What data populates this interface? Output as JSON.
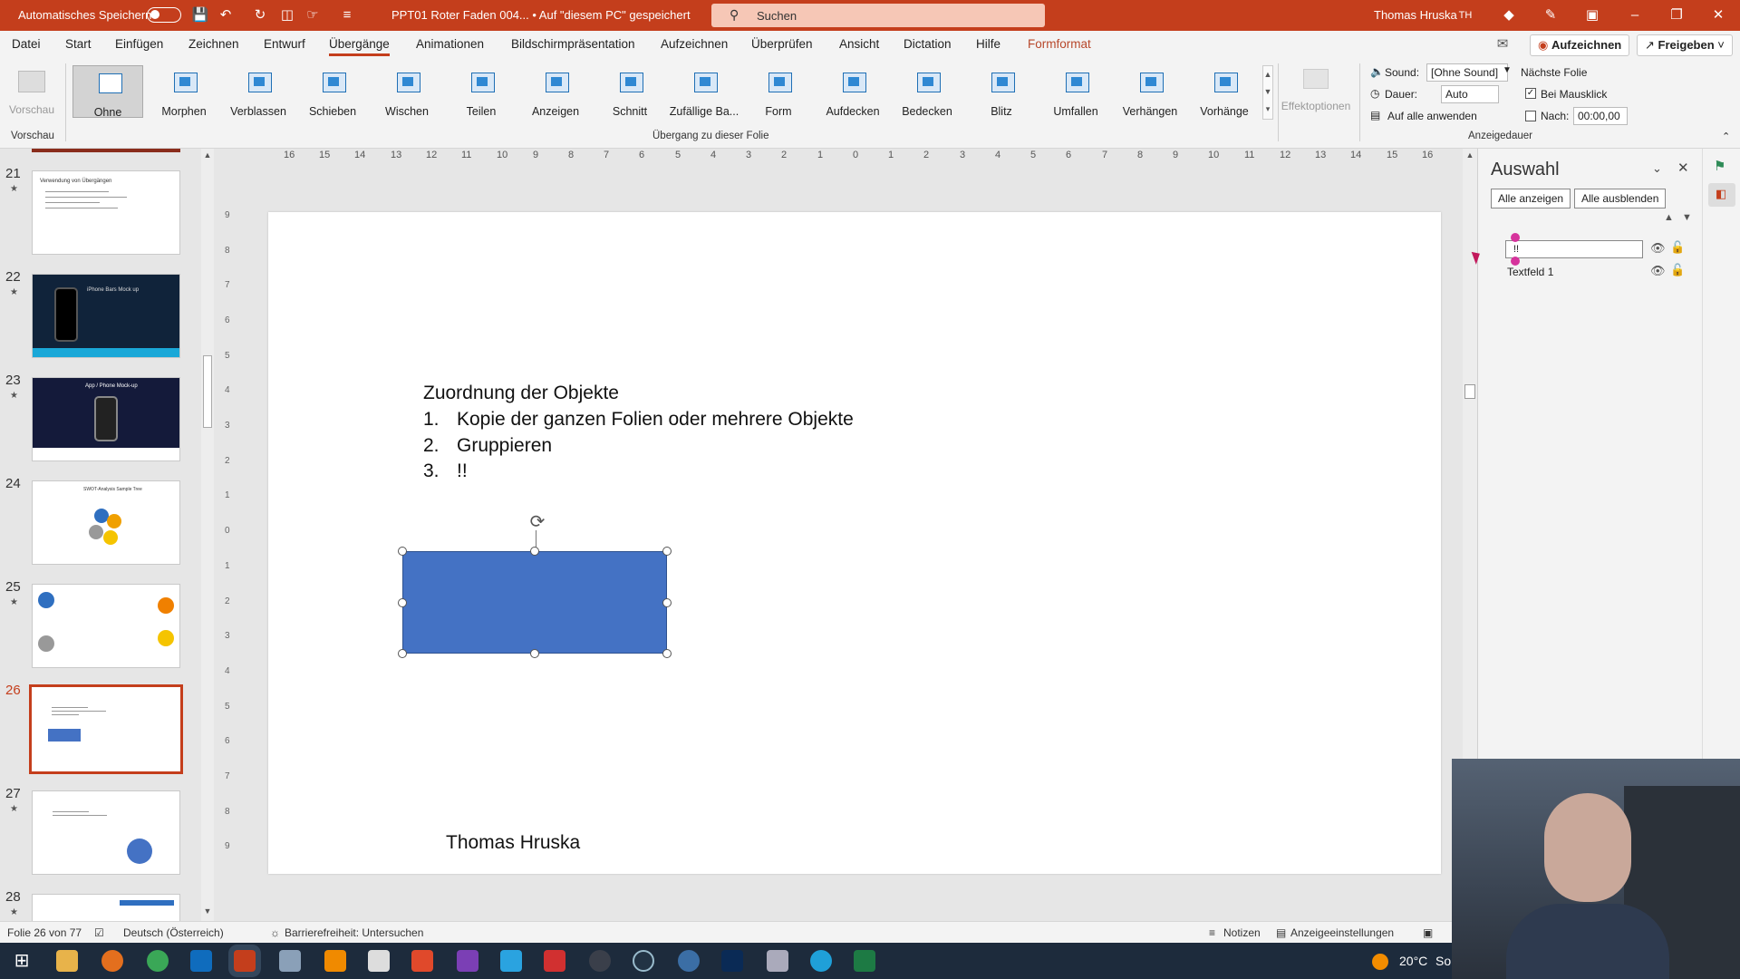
{
  "titlebar": {
    "autosave_label": "Automatisches Speichern",
    "doc_title": "PPT01 Roter Faden 004...  •  Auf \"diesem PC\" gespeichert",
    "search_placeholder": "Suchen",
    "user_name": "Thomas Hruska",
    "user_initials": "TH"
  },
  "menu": {
    "items": [
      "Datei",
      "Start",
      "Einfügen",
      "Zeichnen",
      "Entwurf",
      "Übergänge",
      "Animationen",
      "Bildschirmpräsentation",
      "Aufzeichnen",
      "Überprüfen",
      "Ansicht",
      "Dictation",
      "Hilfe",
      "Formformat"
    ],
    "active": "Übergänge",
    "record_button": "Aufzeichnen",
    "share_button": "Freigeben"
  },
  "ribbon": {
    "preview_label": "Vorschau",
    "preview_group": "Vorschau",
    "transitions": [
      "Ohne",
      "Morphen",
      "Verblassen",
      "Schieben",
      "Wischen",
      "Teilen",
      "Anzeigen",
      "Schnitt",
      "Zufällige Ba...",
      "Form",
      "Aufdecken",
      "Bedecken",
      "Blitz",
      "Umfallen",
      "Verhängen",
      "Vorhänge"
    ],
    "selected_transition": "Ohne",
    "transition_group": "Übergang zu dieser Folie",
    "effect_options": "Effektoptionen",
    "sound_label": "Sound:",
    "sound_value": "[Ohne Sound]",
    "duration_label": "Dauer:",
    "duration_value": "Auto",
    "apply_all": "Auf alle anwenden",
    "next_slide": "Nächste Folie",
    "on_click": "Bei Mausklick",
    "on_click_checked": true,
    "after_label": "Nach:",
    "after_value": "00:00,00",
    "after_checked": false,
    "timing_group": "Anzeigedauer"
  },
  "thumbnails": {
    "items": [
      {
        "num": "21",
        "star": "★"
      },
      {
        "num": "22",
        "star": "★"
      },
      {
        "num": "23",
        "star": "★"
      },
      {
        "num": "24",
        "star": ""
      },
      {
        "num": "25",
        "star": "★"
      },
      {
        "num": "26",
        "star": ""
      },
      {
        "num": "27",
        "star": "★"
      },
      {
        "num": "28",
        "star": "★"
      }
    ],
    "selected": "26",
    "thumb21_title": "Verwendung von Übergängen",
    "thumb22_title": "iPhone Bars Mock up",
    "thumb23_title": "App / Phone Mock-up",
    "thumb24_title": "SWOT-Analysis Sample Tree"
  },
  "ruler": {
    "labels": [
      "16",
      "15",
      "14",
      "13",
      "12",
      "11",
      "10",
      "9",
      "8",
      "7",
      "6",
      "5",
      "4",
      "3",
      "2",
      "1",
      "0",
      "1",
      "2",
      "3",
      "4",
      "5",
      "6",
      "7",
      "8",
      "9",
      "10",
      "11",
      "12",
      "13",
      "14",
      "15",
      "16"
    ],
    "vlabels": [
      "9",
      "8",
      "7",
      "6",
      "5",
      "4",
      "3",
      "2",
      "1",
      "0",
      "1",
      "2",
      "3",
      "4",
      "5",
      "6",
      "7",
      "8",
      "9"
    ]
  },
  "slide": {
    "heading": "Zuordnung  der Objekte",
    "list": [
      {
        "num": "1.",
        "text": "Kopie der ganzen Folien oder mehrere Objekte"
      },
      {
        "num": "2.",
        "text": "Gruppieren"
      },
      {
        "num": "3.",
        "text": "!!"
      }
    ],
    "footer": "Thomas Hruska",
    "shape_color": "#4472c4"
  },
  "selection_pane": {
    "title": "Auswahl",
    "show_all": "Alle anzeigen",
    "hide_all": "Alle ausblenden",
    "rename_value": "!!",
    "items": [
      "Textfeld 1"
    ]
  },
  "status": {
    "slide_info": "Folie 26 von 77",
    "language": "Deutsch (Österreich)",
    "accessibility": "Barrierefreiheit: Untersuchen",
    "notes": "Notizen",
    "display_settings": "Anzeigeeinstellungen"
  },
  "taskbar": {
    "weather": "20°C",
    "weather_trunc": "Sor"
  },
  "colors": {
    "accent": "#c43e1c",
    "shape_fill": "#4472c4",
    "selection_marker": "#d6339c"
  }
}
